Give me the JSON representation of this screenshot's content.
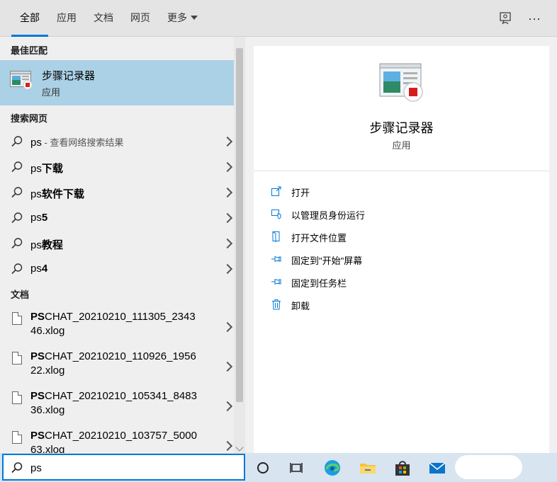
{
  "tabs": [
    {
      "label": "全部",
      "active": true
    },
    {
      "label": "应用"
    },
    {
      "label": "文档"
    },
    {
      "label": "网页"
    },
    {
      "label": "更多"
    }
  ],
  "top_icons": [
    "feedback-icon",
    "more-options-icon"
  ],
  "more_options_glyph": "···",
  "sections": {
    "best_match": "最佳匹配",
    "web_search": "搜索网页",
    "documents": "文档"
  },
  "best_match": {
    "name": "步骤记录器",
    "type": "应用"
  },
  "web_results": [
    {
      "prefix": "ps",
      "suffix": "",
      "sub": " - 查看网络搜索结果"
    },
    {
      "prefix": "ps",
      "suffix": "下载",
      "sub": ""
    },
    {
      "prefix": "ps",
      "suffix": "软件下载",
      "sub": ""
    },
    {
      "prefix": "ps",
      "suffix": "5",
      "sub": ""
    },
    {
      "prefix": "ps",
      "suffix": "教程",
      "sub": ""
    },
    {
      "prefix": "ps",
      "suffix": "4",
      "sub": ""
    }
  ],
  "documents": [
    {
      "bold": "PS",
      "line1": "CHAT_20210210_111305_2343",
      "line2": "46.xlog"
    },
    {
      "bold": "PS",
      "line1": "CHAT_20210210_110926_1956",
      "line2": "22.xlog"
    },
    {
      "bold": "PS",
      "line1": "CHAT_20210210_105341_8483",
      "line2": "36.xlog"
    },
    {
      "bold": "PS",
      "line1": "CHAT_20210210_103757_5000",
      "line2": "63.xlog"
    }
  ],
  "detail": {
    "app_name": "步骤记录器",
    "app_type": "应用",
    "actions": [
      {
        "label": "打开",
        "icon": "open-icon"
      },
      {
        "label": "以管理员身份运行",
        "icon": "run-as-admin-icon"
      },
      {
        "label": "打开文件位置",
        "icon": "file-location-icon"
      },
      {
        "label": "固定到\"开始\"屏幕",
        "icon": "pin-icon"
      },
      {
        "label": "固定到任务栏",
        "icon": "pin-icon"
      },
      {
        "label": "卸载",
        "icon": "trash-icon"
      }
    ]
  },
  "search": {
    "value": "ps"
  },
  "taskbar_icons": [
    "cortana-icon",
    "task-view-icon",
    "edge-icon",
    "file-explorer-icon",
    "store-icon",
    "mail-icon"
  ],
  "colors": {
    "accent": "#0078d4",
    "selected": "#abd1e6"
  }
}
